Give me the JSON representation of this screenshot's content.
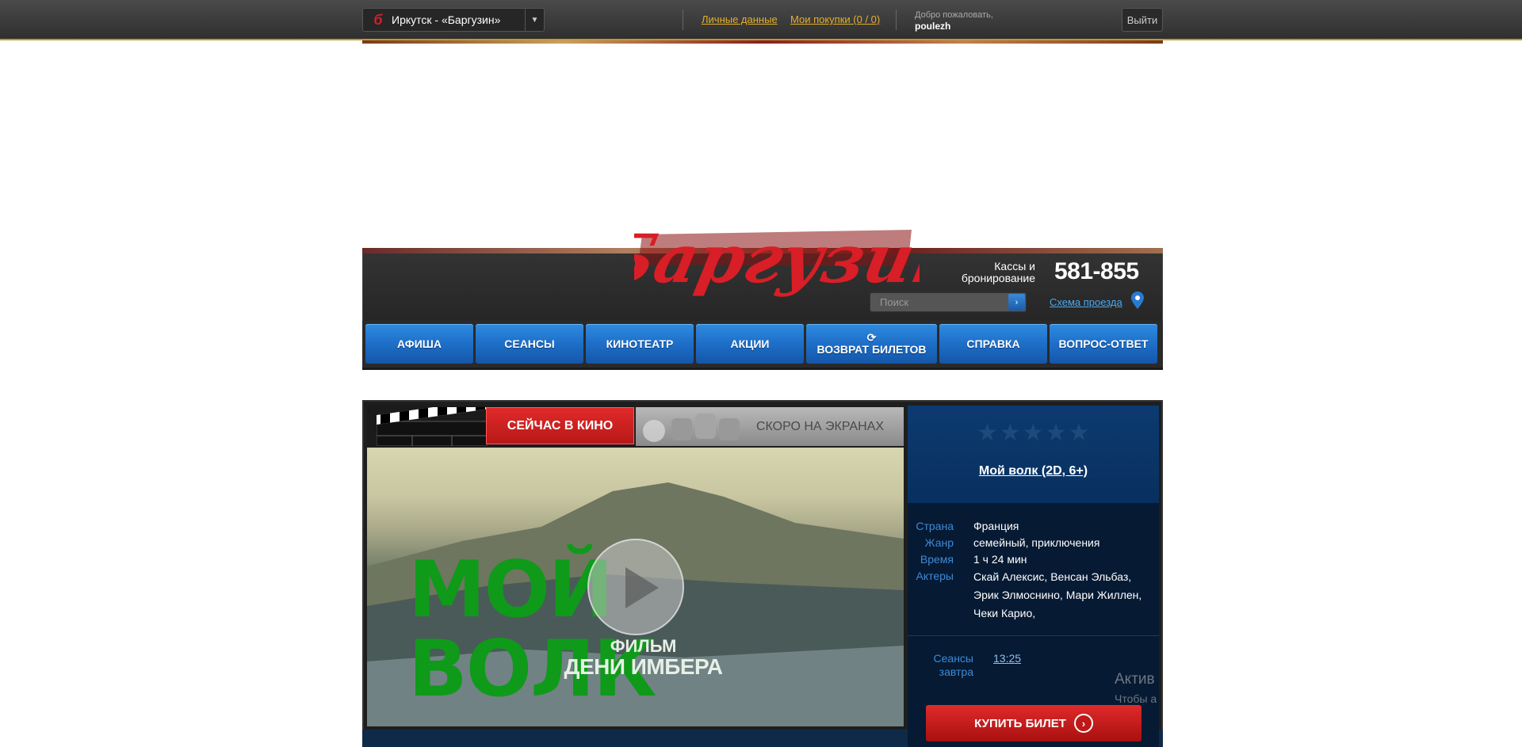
{
  "topbar": {
    "city": "Иркутск - «Баргузин»",
    "personal_link": "Личные данные",
    "purchases_link": "Мои покупки (0 / 0)",
    "welcome_label": "Добро пожаловать,",
    "username": "poulezh",
    "logout": "Выйти"
  },
  "header": {
    "brand": "Баргузин",
    "kassy": "Кассы и бронирование",
    "phone": "581-855",
    "search_placeholder": "Поиск",
    "map_link": "Схема проезда"
  },
  "nav": {
    "items": [
      {
        "label": "АФИША",
        "icon": ""
      },
      {
        "label": "СЕАНСЫ",
        "icon": ""
      },
      {
        "label": "КИНОТЕАТР",
        "icon": ""
      },
      {
        "label": "АКЦИИ",
        "icon": ""
      },
      {
        "label": "ВОЗВРАТ БИЛЕТОВ",
        "icon": "history-icon"
      },
      {
        "label": "СПРАВКА",
        "icon": ""
      },
      {
        "label": "ВОПРОС-ОТВЕТ",
        "icon": ""
      }
    ]
  },
  "tabs": {
    "now": "СЕЙЧАС В КИНО",
    "soon": "СКОРО НА ЭКРАНАХ"
  },
  "video": {
    "title_art": "МОЙ ВОЛК",
    "sub1": "ФИЛЬМ",
    "sub2": "ДЕНИ ИМБЕРА"
  },
  "film": {
    "rating_stars": "★★★★★",
    "title": "Мой волк (2D, 6+)",
    "details": [
      {
        "key": "Страна",
        "value": "Франция"
      },
      {
        "key": "Жанр",
        "value": "семейный, приключения"
      },
      {
        "key": "Время",
        "value": "1 ч 24 мин"
      },
      {
        "key": "Актеры",
        "value": "Скай Алексис, Венсан Эльбаз, Эрик Элмоснино, Мари Жиллен, Чеки Карио,"
      }
    ],
    "sessions_label": "Сеансы завтра",
    "sessions_time": "13:25",
    "buy": "КУПИТЬ БИЛЕТ"
  },
  "watermark": {
    "line1": "Актив",
    "line2": "Чтобы а"
  },
  "colors": {
    "accent_blue": "#1e6ec8",
    "accent_red": "#d0202a",
    "link_gold": "#e5b02a"
  }
}
